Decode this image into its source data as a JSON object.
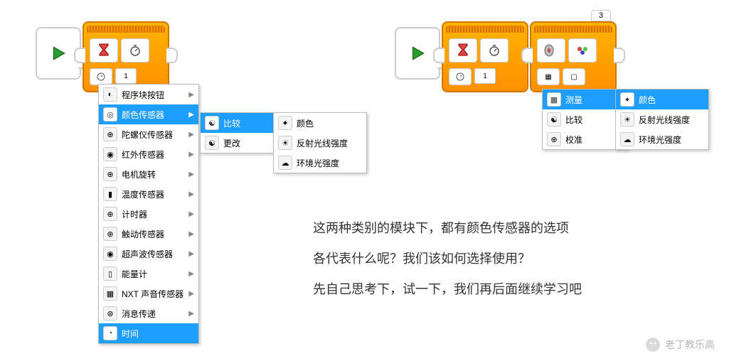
{
  "left": {
    "port": "1",
    "menu1": [
      {
        "icon": "◐",
        "label": "程序块按钮",
        "arrow": true
      },
      {
        "icon": "◎",
        "label": "颜色传感器",
        "arrow": true,
        "selected": true
      },
      {
        "icon": "⊕",
        "label": "陀螺仪传感器",
        "arrow": true
      },
      {
        "icon": "◉",
        "label": "红外传感器",
        "arrow": true
      },
      {
        "icon": "⊕",
        "label": "电机旋转",
        "arrow": true
      },
      {
        "icon": "▮",
        "label": "温度传感器",
        "arrow": true
      },
      {
        "icon": "⊕",
        "label": "计时器",
        "arrow": true
      },
      {
        "icon": "⊕",
        "label": "触动传感器",
        "arrow": true
      },
      {
        "icon": "◉",
        "label": "超声波传感器",
        "arrow": true
      },
      {
        "icon": "▯",
        "label": "能量计",
        "arrow": true
      },
      {
        "icon": "▦",
        "label": "NXT 声音传感器",
        "arrow": true
      },
      {
        "icon": "⊛",
        "label": "消息传递",
        "arrow": true
      },
      {
        "icon": "◔",
        "label": "时间",
        "selected": true
      }
    ],
    "menu2": [
      {
        "icon": "☯",
        "label": "比较",
        "arrow": true,
        "selected": true
      },
      {
        "icon": "☯",
        "label": "更改",
        "arrow": true
      }
    ],
    "menu3": [
      {
        "icon": "✦",
        "label": "颜色"
      },
      {
        "icon": "☀",
        "label": "反射光线强度"
      },
      {
        "icon": "☁",
        "label": "环境光强度"
      }
    ]
  },
  "right": {
    "port1": "1",
    "port3": "3",
    "menu1": [
      {
        "icon": "▦",
        "label": "测量",
        "arrow": true,
        "selected": true
      },
      {
        "icon": "☯",
        "label": "比较",
        "arrow": true
      },
      {
        "icon": "⊕",
        "label": "校准",
        "arrow": true
      }
    ],
    "menu2": [
      {
        "icon": "✦",
        "label": "颜色",
        "selected": true
      },
      {
        "icon": "☀",
        "label": "反射光线强度"
      },
      {
        "icon": "☁",
        "label": "环境光强度"
      }
    ]
  },
  "text": {
    "line1": "这两种类别的模块下，都有颜色传感器的选项",
    "line2": "各代表什么呢？我们该如何选择使用？",
    "line3": "先自己思考下，试一下，我们再后面继续学习吧"
  },
  "watermark": "老丁教乐高"
}
